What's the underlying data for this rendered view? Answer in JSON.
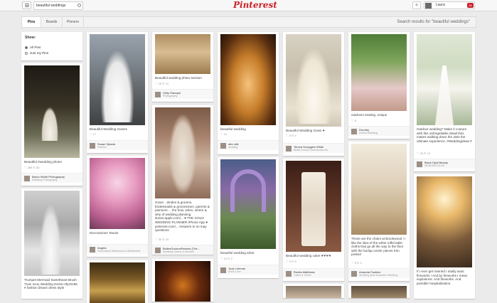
{
  "topbar": {
    "search_value": "beautiful weddings",
    "logo": "Pinterest",
    "plus": "+",
    "user_name": "Laura",
    "notifications": "38"
  },
  "subbar": {
    "tabs": [
      {
        "label": "Pins"
      },
      {
        "label": "Boards"
      },
      {
        "label": "Pinners"
      }
    ],
    "results": "Search results for \"beautiful weddings\""
  },
  "filter": {
    "title": "Show:",
    "options": [
      "All Pins",
      "Just my Pins"
    ]
  },
  "pins": [
    {
      "caption": "Beautiful #wedding photo!",
      "stats": "♡ 285  ↻ 35",
      "pinner": "Baron Webb Photography",
      "board": "Wedding Photography"
    },
    {
      "caption": "Beautiful Wedding Gowns",
      "stats": "♡ 17",
      "pinner": "Susan Spiada",
      "board": "Fashion"
    },
    {
      "caption": "Decorazione Tavolo",
      "stats": "",
      "pinner": "Angela",
      "board": "Decorazioni Matrimonio & Allestimenti"
    },
    {
      "caption": "Beautiful wedding photo session",
      "stats": "♡ 15  ↻ 12",
      "pinner": "Holly Giaoque",
      "board": "Photography"
    },
    {
      "caption": "Gown ...Brides & grooms, bridesmaids & groomsmen, parents & planners ... the how, when, where & why of wedding planning itunes.apple.com/... ♥ THE GOLD WEDDING PLANNER iPhone App ♥ pinterest.com/... Answers to so may questions",
      "stats": "♡ 30  ↻ 15",
      "pinner": "BridesGroomsParents (The ...",
      "board": "Wedding Gowns & Dresses"
    },
    {
      "caption": "beautiful wedding",
      "stats": "♡ 14",
      "pinner": "alex alle",
      "board": "wedding"
    },
    {
      "caption": "beautiful wedding arbor",
      "stats": "♡ 14  ↻ 2",
      "pinner": "Judy Lehman",
      "board": "Arbor Love"
    },
    {
      "caption": "Beautiful Wedding Gown ♥",
      "stats": "♡ 5  ↻ 4",
      "pinner": "Teresa Scroggins White",
      "board": "Bridal Gowns, Accessories etc"
    },
    {
      "caption": "Beautiful wedding cake! ♥'♥'♥'♥",
      "stats": "♡ 3  ↻ 6",
      "pinner": "Renita Matthews",
      "board": "Cakes & Sweet"
    },
    {
      "caption": "outdoors seating. unique",
      "stats": "♡ 8",
      "pinner": "Dorothy",
      "board": "Dream Wedding"
    },
    {
      "caption": "These are the chairs at Brookwood ! I like the idea of the white ruffel table cloths that go all the way to the floor with the burlap center pieces Kim posted",
      "stats": "♡ 5  ↻ 4",
      "pinner": "Amanda Faubion",
      "board": "Wedding (and Amanda's Wedding"
    },
    {
      "caption": "Outdoor wedding? Make it couture with this unforgettable detail that makes walking down the aisle the ultimate experience. #Weddingideas #",
      "stats": "♡ 20  ↻ 12",
      "pinner": "Black Opal Beauty",
      "board": "WEDDING BLISS"
    },
    {
      "caption": "If I ever get married I totally want fireworks ! And by fireworks I mean explosions. And fireworks. And possible hospitalization.",
      "stats": "",
      "pinner": "",
      "board": ""
    },
    {
      "caption": "Trumpet Mermaid Sweetheart Brush Train Ivory Wedding Dress Hfyz0196 # fashion dream dress style",
      "stats": "",
      "pinner": "",
      "board": ""
    }
  ]
}
